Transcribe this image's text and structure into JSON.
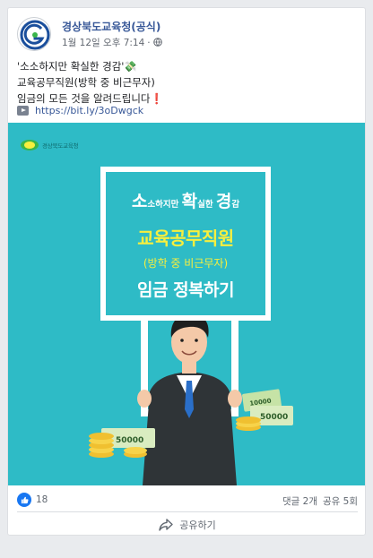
{
  "post": {
    "page_name": "경상북도교육청(공식)",
    "date": "1월 12일 오후 7:14",
    "separator": "·",
    "privacy_icon": "globe-icon",
    "lines": [
      "'소소하지만 확실한 경감'💸",
      "교육공무직원(방학 중 비근무자)",
      "임금의 모든 것을 알려드립니다❗"
    ],
    "link_icon": "play-icon",
    "link": "https://bit.ly/3oDwgck"
  },
  "image": {
    "logo_text": "경상북도교육청",
    "board": {
      "line1": [
        "소",
        "소하지만 ",
        "확",
        "실한 ",
        "경",
        "감"
      ],
      "line2": "교육공무직원",
      "line3": "(방학 중 비근무자)",
      "line4": "임금 정복하기"
    },
    "money_labels": [
      "50000",
      "50000",
      "10000"
    ],
    "colors": {
      "background": "#2ebbc6",
      "highlight": "#f7ef3e"
    }
  },
  "footer": {
    "like_icon": "thumbs-up-icon",
    "like_count": "18",
    "comments": "댓글 2개",
    "shares": "공유 5회",
    "share_icon": "share-arrow-icon",
    "share_label": "공유하기"
  }
}
